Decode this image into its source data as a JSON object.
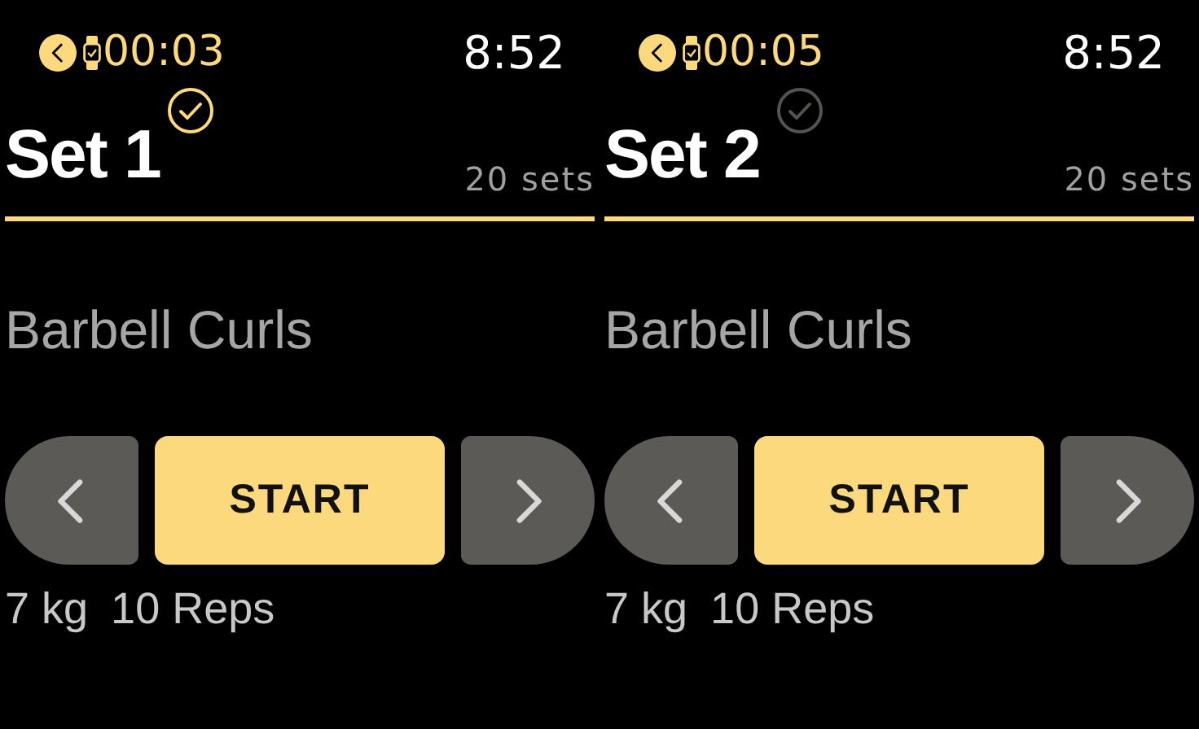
{
  "screens": [
    {
      "timer": "00:03",
      "time": "8:52",
      "title": "Set 1",
      "done": true,
      "set_count": "20 sets",
      "exercise": "Barbell Curls",
      "start_label": "START",
      "weight": "7 kg",
      "reps": "10 Reps"
    },
    {
      "timer": "00:05",
      "time": "8:52",
      "title": "Set 2",
      "done": false,
      "set_count": "20 sets",
      "exercise": "Barbell Curls",
      "start_label": "START",
      "weight": "7 kg",
      "reps": "10 Reps"
    }
  ]
}
